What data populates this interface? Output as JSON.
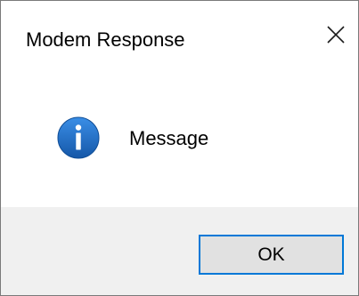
{
  "window": {
    "title": "Modem Response",
    "close_icon": "close-icon"
  },
  "content": {
    "icon": "information-icon",
    "icon_color": "#1f6fc3",
    "message": "Message"
  },
  "footer": {
    "ok_label": "OK",
    "ok_focus_color": "#0078d7"
  }
}
